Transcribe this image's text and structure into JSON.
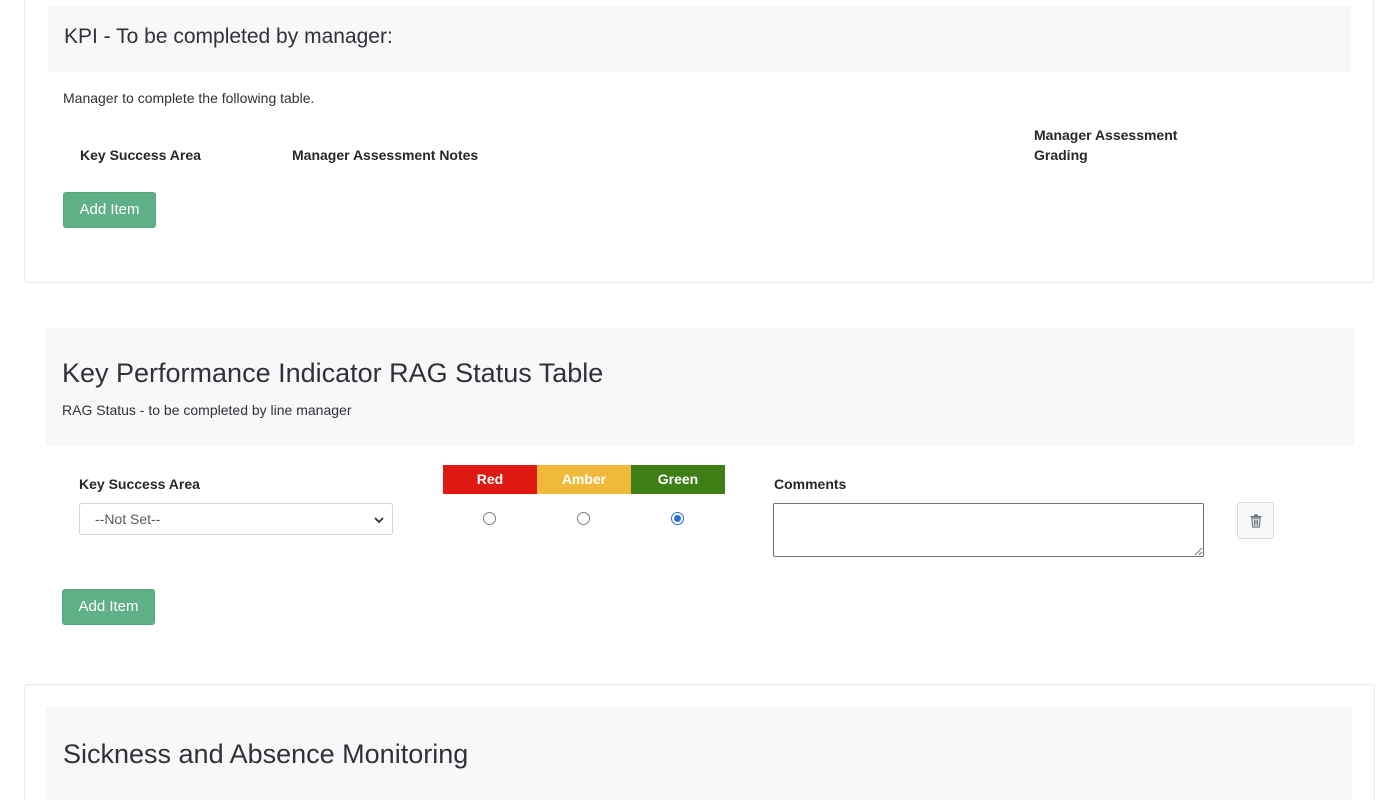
{
  "kpi_section": {
    "title": "KPI - To be completed by manager:",
    "description": "Manager to complete the following table.",
    "columns": {
      "key_success_area": "Key Success Area",
      "notes": "Manager Assessment Notes",
      "grading": "Manager Assessment Grading"
    },
    "add_item_label": "Add Item"
  },
  "rag_section": {
    "title": "Key Performance Indicator RAG Status Table",
    "subtitle": "RAG Status - to be completed by line manager",
    "columns": {
      "key_success_area": "Key Success Area",
      "red": "Red",
      "amber": "Amber",
      "green": "Green",
      "comments": "Comments"
    },
    "colors": {
      "red": "#e01a12",
      "amber": "#f0b93a",
      "green": "#3f7d17"
    },
    "row": {
      "key_success_area_value": "--Not Set--",
      "selected_status": "Green",
      "comments_value": "",
      "delete_icon": "trash-icon"
    },
    "add_item_label": "Add Item"
  },
  "sickness_section": {
    "title": "Sickness and Absence Monitoring"
  },
  "accent_colors": {
    "add_button": "#5fb087"
  }
}
